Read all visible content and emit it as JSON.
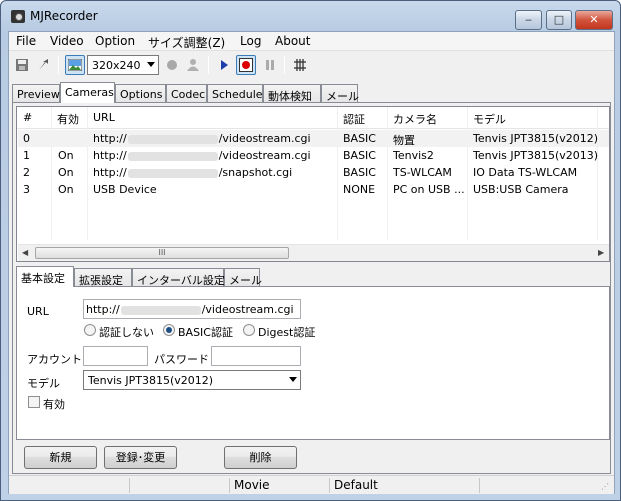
{
  "window": {
    "title": "MJRecorder",
    "min": "_",
    "max": "□",
    "close": "x"
  },
  "menu": [
    "File",
    "Video",
    "Option",
    "サイズ調整(Z)",
    "Log",
    "About"
  ],
  "toolbar": {
    "size_select": "320x240"
  },
  "main_tabs": [
    "Preview",
    "Cameras",
    "Options",
    "Codec",
    "Schedule",
    "動体検知",
    "メール"
  ],
  "cameras": {
    "columns": [
      "#",
      "有効",
      "URL",
      "認証",
      "カメラ名",
      "モデル"
    ],
    "rows": [
      {
        "num": "0",
        "enabled": "",
        "url_prefix": "http://",
        "url_suffix": "/videostream.cgi",
        "auth": "BASIC",
        "name": "物置",
        "model": "Tenvis JPT3815(v2012)"
      },
      {
        "num": "1",
        "enabled": "On",
        "url_prefix": "http://",
        "url_suffix": "/videostream.cgi",
        "auth": "BASIC",
        "name": "Tenvis2",
        "model": "Tenvis JPT3815(v2013)"
      },
      {
        "num": "2",
        "enabled": "On",
        "url_prefix": "http://",
        "url_suffix": "/snapshot.cgi",
        "auth": "BASIC",
        "name": "TS-WLCAM",
        "model": "IO Data TS-WLCAM"
      },
      {
        "num": "3",
        "enabled": "On",
        "url_prefix": "USB Device",
        "url_suffix": "",
        "auth": "NONE",
        "name": "PC on USB ...",
        "model": "USB:USB Camera"
      }
    ],
    "scroll_grip": "III"
  },
  "sub_tabs": [
    "基本設定",
    "拡張設定",
    "インターバル設定",
    "メール"
  ],
  "form": {
    "url_label": "URL",
    "url_prefix": "http://",
    "url_suffix": "/videostream.cgi",
    "auth_options": [
      "認証しない",
      "BASIC認証",
      "Digest認証"
    ],
    "auth_selected": "BASIC認証",
    "account_label": "アカウント",
    "account_value": "",
    "password_label": "パスワード",
    "password_value": "",
    "model_label": "モデル",
    "model_value": "Tenvis JPT3815(v2012)",
    "enabled_label": "有効",
    "enabled_checked": false
  },
  "buttons": {
    "new": "新規",
    "register": "登録･変更",
    "delete": "削除"
  },
  "status": {
    "seg1": "",
    "seg2": "",
    "movie": "Movie",
    "default": "Default"
  }
}
